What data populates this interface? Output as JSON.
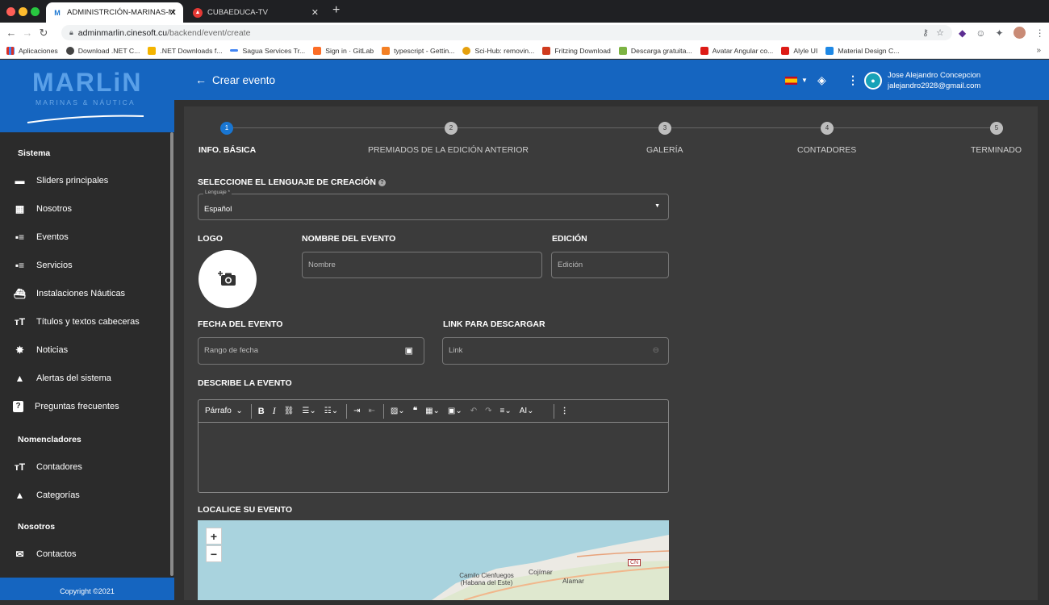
{
  "browser": {
    "tabs": [
      {
        "label": "ADMINISTRCIÓN-MARINAS-M",
        "favicon": "M"
      },
      {
        "label": "CUBAEDUCA-TV"
      }
    ],
    "url_host": "adminmarlin.cinesoft.cu",
    "url_path": "/backend/event/create",
    "bookmarks": [
      {
        "label": "Aplicaciones",
        "color": "#d93025"
      },
      {
        "label": "Download .NET C...",
        "color": "#444444"
      },
      {
        "label": ".NET Downloads f...",
        "color": "#f4b400"
      },
      {
        "label": "Sagua Services Tr...",
        "color": "#4285f4"
      },
      {
        "label": "Sign in · GitLab",
        "color": "#fc6d26"
      },
      {
        "label": "typescript - Gettin...",
        "color": "#f48024"
      },
      {
        "label": "Sci-Hub: removin...",
        "color": "#e5a00d"
      },
      {
        "label": "Fritzing Download",
        "color": "#d03b1e"
      },
      {
        "label": "Descarga gratuita...",
        "color": "#7cb342"
      },
      {
        "label": "Avatar Angular co...",
        "color": "#dd1b16"
      },
      {
        "label": "Alyle UI",
        "color": "#dd1b16"
      },
      {
        "label": "Material Design C...",
        "color": "#1e88e5"
      }
    ]
  },
  "sidebar": {
    "logo_text": "MARLiN",
    "logo_tagline": "MARINAS & NÁUTICA",
    "sections": [
      {
        "title": "Sistema",
        "items": [
          {
            "label": "Sliders principales",
            "icon": "slider-icon"
          },
          {
            "label": "Nosotros",
            "icon": "building-icon"
          },
          {
            "label": "Eventos",
            "icon": "list-icon"
          },
          {
            "label": "Servicios",
            "icon": "list-icon"
          },
          {
            "label": "Instalaciones Náuticas",
            "icon": "boat-icon"
          },
          {
            "label": "Títulos y textos cabeceras",
            "icon": "text-icon"
          },
          {
            "label": "Noticias",
            "icon": "badge-icon"
          },
          {
            "label": "Alertas del sistema",
            "icon": "warning-icon"
          },
          {
            "label": "Preguntas frecuentes",
            "icon": "help-icon"
          }
        ]
      },
      {
        "title": "Nomencladores",
        "items": [
          {
            "label": "Contadores",
            "icon": "text-icon"
          },
          {
            "label": "Categorías",
            "icon": "category-icon"
          }
        ]
      },
      {
        "title": "Nosotros",
        "items": [
          {
            "label": "Contactos",
            "icon": "mail-icon"
          }
        ]
      }
    ],
    "copyright": "Copyright ©2021"
  },
  "header": {
    "title": "Crear evento",
    "user_name": "Jose Alejandro Concepcion",
    "user_email": "jalejandro2928@gmail.com"
  },
  "stepper": {
    "steps": [
      {
        "number": "1",
        "label": "INFO. BÁSICA"
      },
      {
        "number": "2",
        "label": "PREMIADOS DE LA EDICIÓN ANTERIOR"
      },
      {
        "number": "3",
        "label": "GALERÍA"
      },
      {
        "number": "4",
        "label": "CONTADORES"
      },
      {
        "number": "5",
        "label": "TERMINADO"
      }
    ]
  },
  "form": {
    "language_heading": "SELECCIONE EL LENGUAJE DE CREACIÓN",
    "language_field_label": "Lenguaje *",
    "language_value": "Español",
    "logo_label": "LOGO",
    "name_label": "NOMBRE DEL EVENTO",
    "name_placeholder": "Nombre",
    "edition_label": "EDICIÓN",
    "edition_placeholder": "Edición",
    "date_label": "FECHA DEL EVENTO",
    "date_placeholder": "Rango de fecha",
    "link_label": "LINK PARA DESCARGAR",
    "link_placeholder": "Link",
    "describe_label": "DESCRIBE LA EVENTO",
    "editor_paragraph": "Párrafo",
    "locate_label": "LOCALICE SU EVENTO"
  },
  "map": {
    "zoom_in": "+",
    "zoom_out": "−",
    "places": [
      "Camilo Cienfuegos (Habana del Este)",
      "Cojímar",
      "Alamar",
      "CN"
    ]
  }
}
